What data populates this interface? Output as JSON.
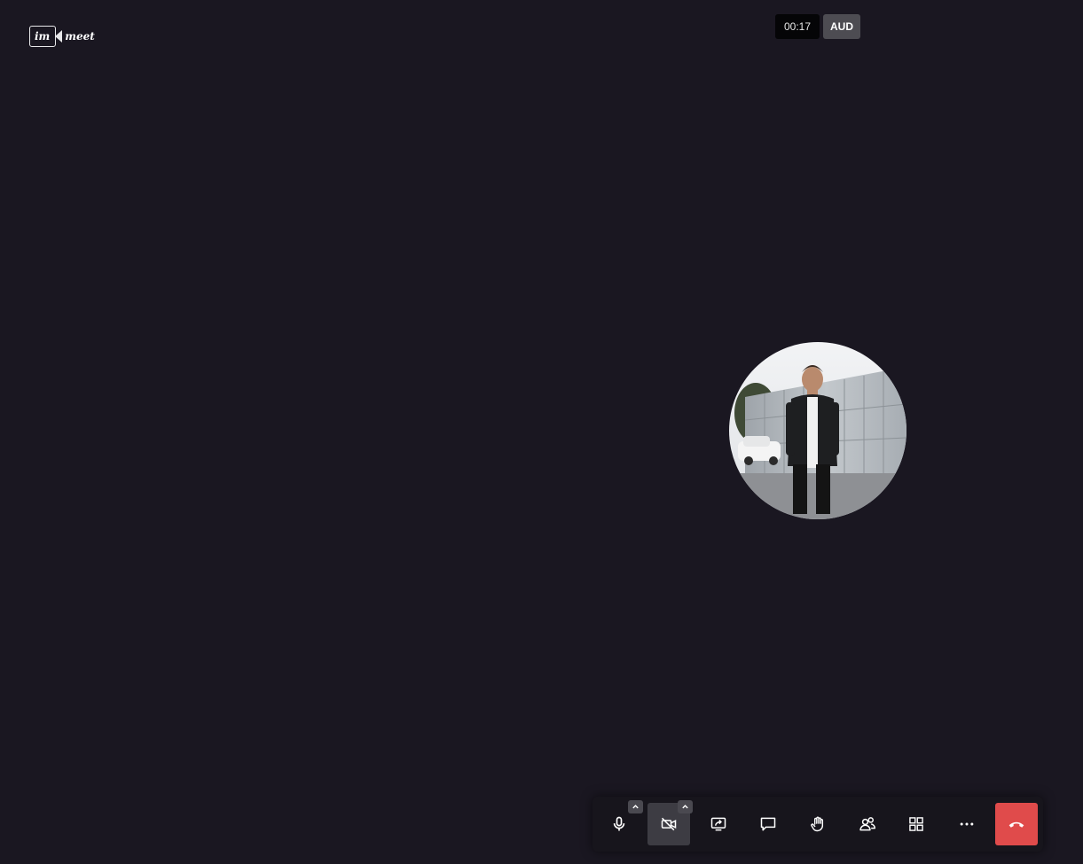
{
  "logo": {
    "box_text": "im",
    "word": "meet"
  },
  "timer": {
    "elapsed": "00:17"
  },
  "audio_badge": {
    "label": "AUD"
  },
  "participant": {
    "avatar_icon": "participant-photo"
  },
  "toolbar": {
    "buttons": [
      {
        "name": "microphone",
        "icon": "microphone-icon",
        "has_options": true
      },
      {
        "name": "camera",
        "icon": "camera-off-icon",
        "state": "off",
        "has_options": true
      },
      {
        "name": "share-screen",
        "icon": "share-screen-icon"
      },
      {
        "name": "chat",
        "icon": "chat-icon"
      },
      {
        "name": "raise-hand",
        "icon": "hand-icon"
      },
      {
        "name": "participants",
        "icon": "participants-icon"
      },
      {
        "name": "tile-view",
        "icon": "grid-icon"
      },
      {
        "name": "more",
        "icon": "more-icon"
      },
      {
        "name": "hangup",
        "icon": "hangup-icon"
      }
    ]
  },
  "colors": {
    "background": "#1a1721",
    "toolbar": "#17151c",
    "active_button": "#3d3c43",
    "hangup": "#e04b4b",
    "timer_bg": "#050507",
    "badge_bg": "#4d4c52"
  }
}
